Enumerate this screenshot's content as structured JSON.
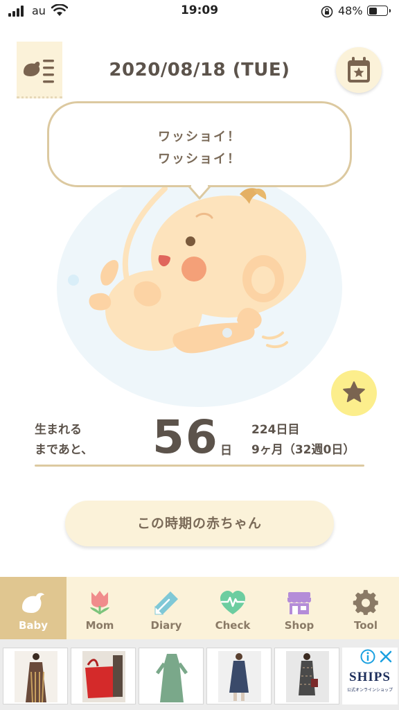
{
  "status_bar": {
    "carrier": "au",
    "time": "19:09",
    "battery_percent": "48%",
    "battery_level": 0.48
  },
  "header": {
    "date": "2020/08/18 (TUE)",
    "menu_icon": "baby-list-icon",
    "calendar_icon": "calendar-star-icon"
  },
  "speech_bubble": {
    "line1": "ワッショイ！",
    "line2": "ワッショイ！"
  },
  "countdown": {
    "label_line1": "生まれる",
    "label_line2": "まであと、",
    "days_remaining": "56",
    "days_unit": "日",
    "day_count": "224日目",
    "month_week": "9ヶ月（32週0日）"
  },
  "cta": {
    "label": "この時期の赤ちゃん"
  },
  "tabs": [
    {
      "label": "Baby",
      "icon": "bird-icon",
      "active": true
    },
    {
      "label": "Mom",
      "icon": "tulip-icon",
      "active": false
    },
    {
      "label": "Diary",
      "icon": "pencil-icon",
      "active": false
    },
    {
      "label": "Check",
      "icon": "heartbeat-icon",
      "active": false
    },
    {
      "label": "Shop",
      "icon": "store-icon",
      "active": false
    },
    {
      "label": "Tool",
      "icon": "gear-icon",
      "active": false
    }
  ],
  "ad": {
    "brand": "SHIPS",
    "brand_sub": "公式オンラインショップ"
  },
  "colors": {
    "accent_tan": "#e0c690",
    "cream": "#fbf2d9",
    "star_yellow": "#fcee8c",
    "text_brown": "#5c534b"
  }
}
